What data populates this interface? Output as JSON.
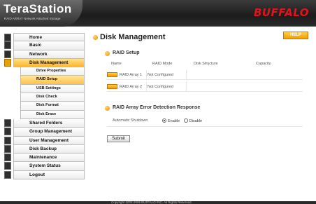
{
  "header": {
    "logo_title": "TeraStation",
    "logo_subtitle": "RAID ARRAY Network Attached Storage",
    "brand": "BUFFALO"
  },
  "sidebar": {
    "items": [
      {
        "label": "Home",
        "icon": "home-icon"
      },
      {
        "label": "Basic",
        "icon": "basic-settings-icon"
      },
      {
        "label": "Network",
        "icon": "network-icon"
      },
      {
        "label": "Disk Management",
        "icon": "disk-management-icon",
        "active": true
      },
      {
        "label": "Shared Folders",
        "icon": "shared-folders-icon"
      },
      {
        "label": "Group Management",
        "icon": "group-management-icon"
      },
      {
        "label": "User Management",
        "icon": "user-management-icon"
      },
      {
        "label": "Disk Backup",
        "icon": "disk-backup-icon"
      },
      {
        "label": "Maintenance",
        "icon": "maintenance-icon"
      },
      {
        "label": "System Status",
        "icon": "system-status-icon"
      },
      {
        "label": "Logout",
        "icon": "logout-icon"
      }
    ],
    "sub_items": [
      {
        "label": "Drive Properties"
      },
      {
        "label": "RAID Setup",
        "active": true
      },
      {
        "label": "USB Settings"
      },
      {
        "label": "Disk Check"
      },
      {
        "label": "Disk Format"
      },
      {
        "label": "Disk Erase"
      }
    ]
  },
  "main": {
    "title": "Disk Management",
    "help_label": "HELP",
    "raid_setup": {
      "title": "RAID Setup",
      "columns": [
        "Name",
        "RAID Mode",
        "Disk Structure",
        "Capacity"
      ],
      "rows": [
        {
          "name": "RAID Array 1",
          "mode": "Not Configured"
        },
        {
          "name": "RAID Array 2",
          "mode": "Not Configured"
        }
      ]
    },
    "error_detection": {
      "title": "RAID Array Error Detection Response",
      "label": "Automatic Shutdown",
      "options": [
        {
          "label": "Enable",
          "checked": true
        },
        {
          "label": "Disable",
          "checked": false
        }
      ]
    },
    "submit_label": "Submit"
  },
  "footer": {
    "copyright": "Copyright 2002-2006 BUFFALO INC. All Rights Reserved."
  },
  "colors": {
    "accent": "#f39b00",
    "brand": "#e0141e",
    "header_bg": "#1c1c1c"
  }
}
